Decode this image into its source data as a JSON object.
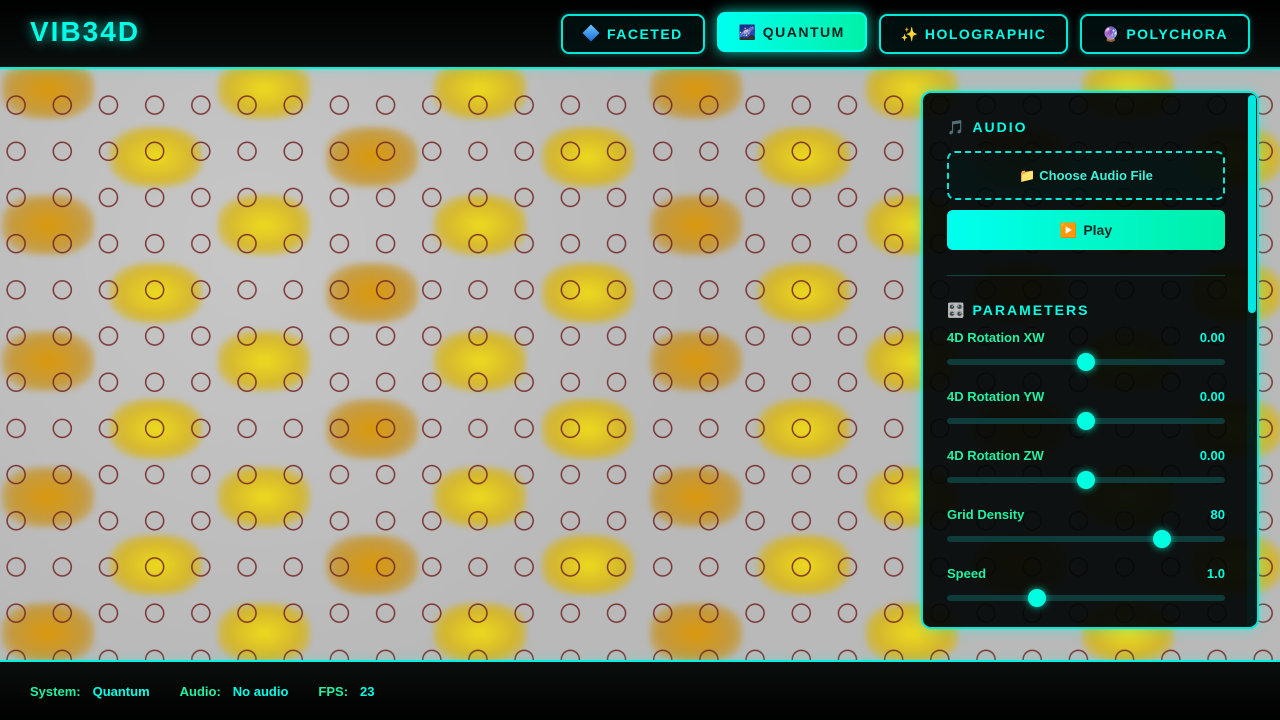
{
  "app": {
    "title": "VIB34D"
  },
  "nav": {
    "items": [
      {
        "label": "FACETED",
        "icon": "blue-diamond-icon",
        "active": false
      },
      {
        "label": "QUANTUM",
        "icon": "milky-way-icon",
        "active": true
      },
      {
        "label": "HOLOGRAPHIC",
        "icon": "sparkles-icon",
        "active": false
      },
      {
        "label": "POLYCHORA",
        "icon": "crystal-ball-icon",
        "active": false
      }
    ]
  },
  "audio": {
    "title": "AUDIO",
    "icon": "musical-note-icon",
    "file_button": "Choose Audio File",
    "file_icon": "folder-icon",
    "play_button": "Play",
    "play_icon": "play-icon"
  },
  "parameters": {
    "title": "PARAMETERS",
    "icon": "control-knobs-icon",
    "items": [
      {
        "label": "4D Rotation XW",
        "value": "0.00",
        "fraction": 0.5
      },
      {
        "label": "4D Rotation YW",
        "value": "0.00",
        "fraction": 0.5
      },
      {
        "label": "4D Rotation ZW",
        "value": "0.00",
        "fraction": 0.5
      },
      {
        "label": "Grid Density",
        "value": "80",
        "fraction": 0.775
      },
      {
        "label": "Speed",
        "value": "1.0",
        "fraction": 0.325
      }
    ]
  },
  "status": {
    "system_label": "System:",
    "system_value": "Quantum",
    "audio_label": "Audio:",
    "audio_value": "No audio",
    "fps_label": "FPS:",
    "fps_value": "23"
  },
  "colors": {
    "accent": "#00ffe6",
    "accent_green": "#22f0a0",
    "canvas_gray": "#b9b9b9",
    "blob_yellow": "#e8d400",
    "ring_red": "#6e1e1e"
  }
}
